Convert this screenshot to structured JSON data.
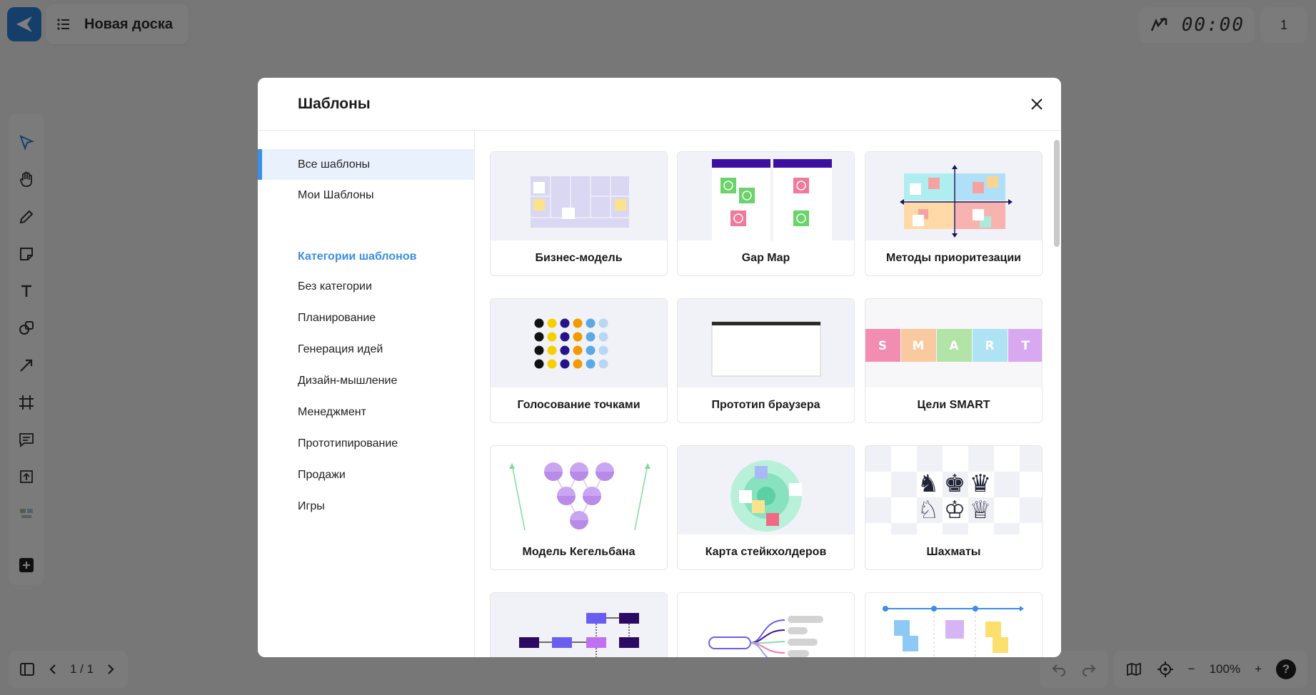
{
  "app": {
    "board_title": "Новая доска",
    "timer": "00:00",
    "users_count": "1",
    "page_indicator": "1 / 1",
    "zoom": "100%",
    "help": "?"
  },
  "toolbar": {
    "tools": [
      "select-icon",
      "hand-icon",
      "pen-icon",
      "sticky-note-icon",
      "text-icon",
      "shapes-icon",
      "arrow-icon",
      "frame-icon",
      "comment-icon",
      "upload-icon",
      "templates-icon",
      "add-icon"
    ]
  },
  "modal": {
    "title": "Шаблоны",
    "sidebar": {
      "all_templates": "Все шаблоны",
      "my_templates": "Мои Шаблоны",
      "categories_title": "Категории шаблонов",
      "categories": [
        "Без категории",
        "Планирование",
        "Генерация идей",
        "Дизайн-мышление",
        "Менеджмент",
        "Прототипирование",
        "Продажи",
        "Игры"
      ]
    },
    "cards": [
      {
        "label": "Бизнес-модель"
      },
      {
        "label": "Gap Map"
      },
      {
        "label": "Методы приоритезации"
      },
      {
        "label": "Голосование точками"
      },
      {
        "label": "Прототип браузера"
      },
      {
        "label": "Цели SMART",
        "letters": [
          "S",
          "M",
          "A",
          "R",
          "T"
        ]
      },
      {
        "label": "Модель Кегельбана"
      },
      {
        "label": "Карта стейкхолдеров"
      },
      {
        "label": "Шахматы"
      },
      {
        "label": ""
      },
      {
        "label": ""
      },
      {
        "label": ""
      }
    ]
  },
  "colors": {
    "accent": "#3a8ee6",
    "active_bg": "#e9f2fc",
    "overlay": "rgba(0,0,0,0.5)"
  }
}
